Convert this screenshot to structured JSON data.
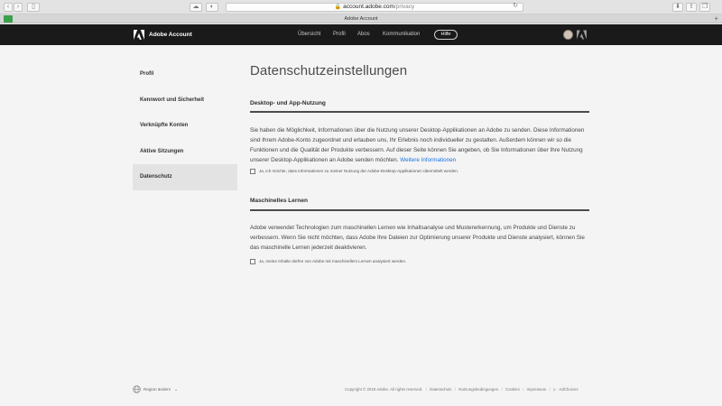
{
  "browser": {
    "url_host": "account.adobe.com",
    "url_path": "/privacy",
    "tab_title": "Adobe Account"
  },
  "header": {
    "brand": "Adobe Account",
    "nav": [
      "Übersicht",
      "Profil",
      "Abos",
      "Kommunikation"
    ],
    "help": "Hilfe"
  },
  "sidebar": {
    "items": [
      {
        "label": "Profil"
      },
      {
        "label": "Kennwort und Sicherheit"
      },
      {
        "label": "Verknüpfte Konten"
      },
      {
        "label": "Aktive Sitzungen"
      },
      {
        "label": "Datenschutz"
      }
    ]
  },
  "main": {
    "title": "Datenschutzeinstellungen",
    "desktop": {
      "heading": "Desktop- und App-Nutzung",
      "body": "Sie haben die Möglichkeit, Informationen über die Nutzung unserer Desktop-Applikationen an Adobe zu senden. Diese Informationen sind Ihrem Adobe-Konto zugeordnet und erlauben uns, Ihr Erlebnis noch individueller zu gestalten. Außerdem können wir so die Funktionen und die Qualität der Produkte verbessern. Auf dieser Seite können Sie angeben, ob Sie Informationen über Ihre Nutzung unserer Desktop-Applikationen an Adobe senden möchten.",
      "link": "Weitere Informationen",
      "checkbox": "Ja, ich möchte, dass Informationen zu meiner Nutzung der Adobe-Desktop-Applikationen übermittelt werden."
    },
    "ml": {
      "heading": "Maschinelles Lernen",
      "body": "Adobe verwendet Technologien zum maschinellen Lernen wie Inhaltsanalyse und Mustererkennung, um Produkte und Dienste zu verbessern. Wenn Sie nicht möchten, dass Adobe Ihre Dateien zur Optimierung unserer Produkte und Dienste analysiert, können Sie das maschinelle Lernen jederzeit deaktivieren.",
      "checkbox": "Ja, meine Inhalte dürfen von Adobe mit maschinellem Lernen analysiert werden."
    }
  },
  "footer": {
    "region": "Region ändern",
    "copyright": "Copyright © 2018 Adobe. All rights reserved.",
    "links": [
      "Datenschutz",
      "Nutzungsbedingungen",
      "Cookies",
      "Impressum",
      "AdChoices"
    ]
  }
}
